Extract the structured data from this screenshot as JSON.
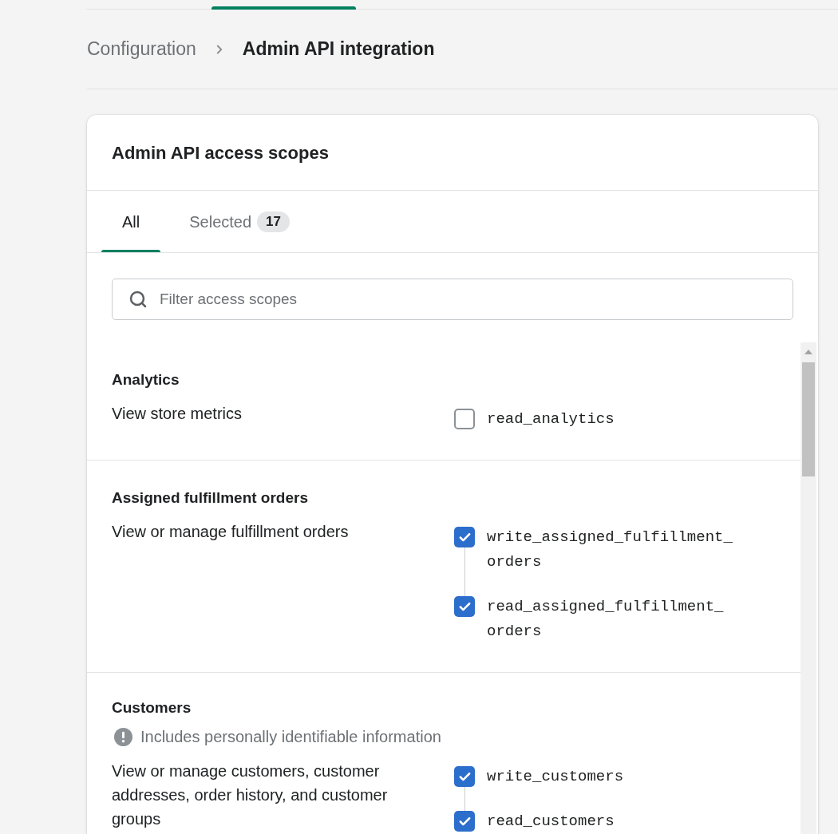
{
  "breadcrumb": [
    {
      "label": "Configuration",
      "current": false
    },
    {
      "label": "Admin API integration",
      "current": true
    }
  ],
  "card": {
    "title": "Admin API access scopes",
    "tabs": [
      {
        "label": "All",
        "selected": true
      },
      {
        "label": "Selected",
        "badge": "17",
        "selected": false
      }
    ],
    "search": {
      "placeholder": "Filter access scopes"
    },
    "sections": [
      {
        "title": "Analytics",
        "description": "View store metrics",
        "scopes": [
          {
            "name": "read_analytics",
            "checked": false
          }
        ]
      },
      {
        "title": "Assigned fulfillment orders",
        "description": "View or manage fulfillment orders",
        "scopes": [
          {
            "name": "write_assigned_fulfillment_orders",
            "checked": true
          },
          {
            "name": "read_assigned_fulfillment_orders",
            "checked": true
          }
        ]
      },
      {
        "title": "Customers",
        "notice": "Includes personally identifiable information",
        "description": "View or manage customers, customer addresses, order history, and customer groups",
        "scopes": [
          {
            "name": "write_customers",
            "checked": true
          },
          {
            "name": "read_customers",
            "checked": true
          }
        ]
      }
    ]
  }
}
